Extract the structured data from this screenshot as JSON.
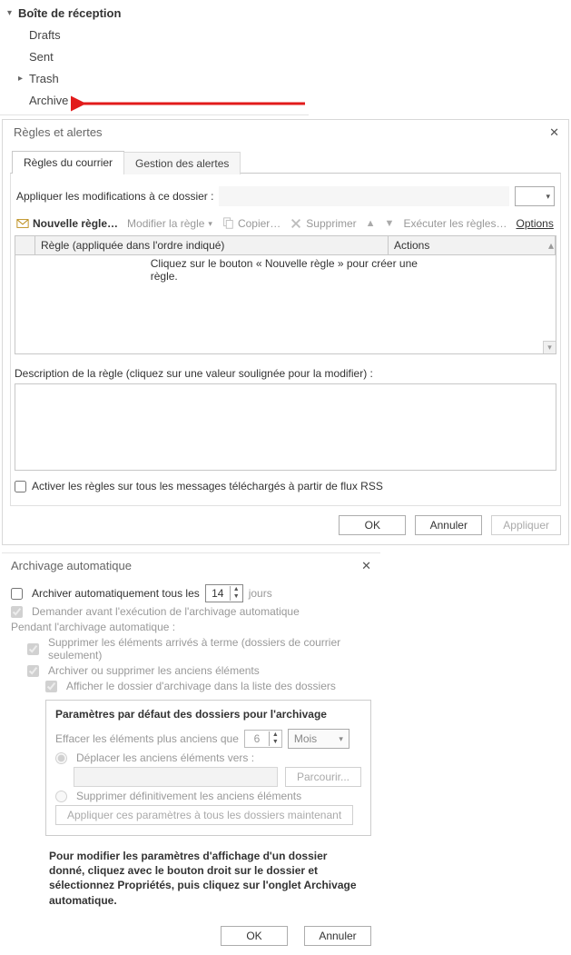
{
  "tree": {
    "inbox_label": "Boîte de réception",
    "drafts": "Drafts",
    "sent": "Sent",
    "trash": "Trash",
    "archive": "Archive"
  },
  "rules": {
    "title": "Règles et alertes",
    "tab_rules": "Règles du courrier",
    "tab_alerts": "Gestion des alertes",
    "apply_label": "Appliquer les modifications à ce dossier :",
    "toolbar": {
      "new": "Nouvelle règle…",
      "modify": "Modifier la règle",
      "copy": "Copier…",
      "delete": "Supprimer",
      "run": "Exécuter les règles…",
      "options": "Options"
    },
    "col_header": "Règle (appliquée dans l'ordre indiqué)",
    "col_actions": "Actions",
    "empty_hint": "Cliquez sur le bouton « Nouvelle règle » pour créer une règle.",
    "desc_label": "Description de la règle (cliquez sur une valeur soulignée pour la modifier) :",
    "rss_label": "Activer les règles sur tous les messages téléchargés à partir de flux RSS",
    "ok": "OK",
    "cancel": "Annuler",
    "apply": "Appliquer"
  },
  "aa": {
    "title": "Archivage automatique",
    "run_every": "Archiver automatiquement tous les",
    "run_every_value": "14",
    "days_label": "jours",
    "prompt": "Demander avant l'exécution de l'archivage automatique",
    "during": "Pendant l'archivage automatique :",
    "del_expired": "Supprimer les éléments arrivés à terme (dossiers de courrier seulement)",
    "arch_or_del": "Archiver ou supprimer les anciens éléments",
    "show_folder": "Afficher le dossier d'archivage dans la liste des dossiers",
    "fieldset_title": "Paramètres par défaut des dossiers pour l'archivage",
    "clean_older": "Effacer les éléments plus anciens que",
    "clean_value": "6",
    "clean_unit": "Mois",
    "move_to": "Déplacer les anciens éléments vers :",
    "browse": "Parcourir...",
    "perm_delete": "Supprimer définitivement les anciens éléments",
    "apply_all": "Appliquer ces paramètres à tous les dossiers maintenant",
    "note": "Pour modifier les paramètres d'affichage d'un dossier donné, cliquez avec le bouton droit sur le dossier et sélectionnez Propriétés, puis cliquez sur l'onglet Archivage automatique.",
    "ok": "OK",
    "cancel": "Annuler"
  }
}
